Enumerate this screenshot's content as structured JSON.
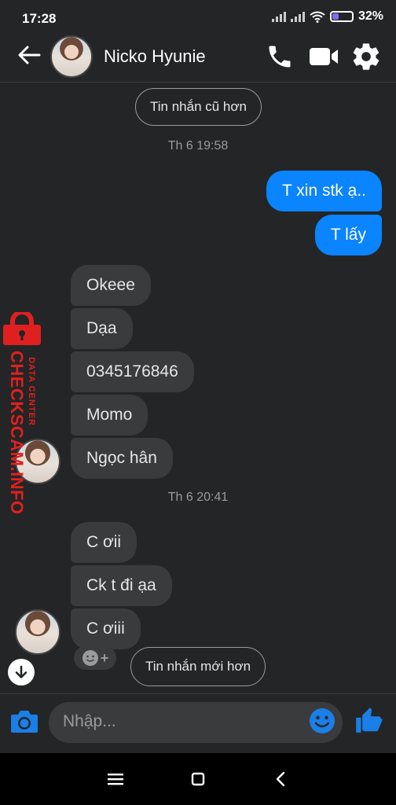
{
  "status_bar": {
    "time": "17:28",
    "battery": "32%",
    "battery_level": 0.32
  },
  "header": {
    "contact_name": "Nicko Hyunie"
  },
  "older_messages_label": "Tin nhắn cũ hơn",
  "newer_messages_label": "Tin nhắn mới hơn",
  "timestamps": [
    "Th 6 19:58",
    "Th 6 20:41"
  ],
  "outgoing": [
    "T xin stk ạ..",
    "T lấy"
  ],
  "incoming_group1": [
    "Okeee",
    "Dạa",
    "0345176846",
    "Momo",
    "Ngọc hân"
  ],
  "incoming_group2": [
    "C ơii",
    "Ck t đi ạa",
    "C ơiii"
  ],
  "watermark": {
    "main": "CHECKSCAM.INFO",
    "sub": "DATA CENTER"
  },
  "composer": {
    "placeholder": "Nhập..."
  },
  "colors": {
    "accent": "#0a84ff",
    "bubble_in": "#3a3b3c",
    "background": "#242526",
    "watermark": "#e02020"
  },
  "icons": [
    "back-arrow-icon",
    "phone-icon",
    "video-icon",
    "gear-icon",
    "camera-icon",
    "emoji-icon",
    "thumbs-up-icon",
    "arrow-down-icon"
  ]
}
